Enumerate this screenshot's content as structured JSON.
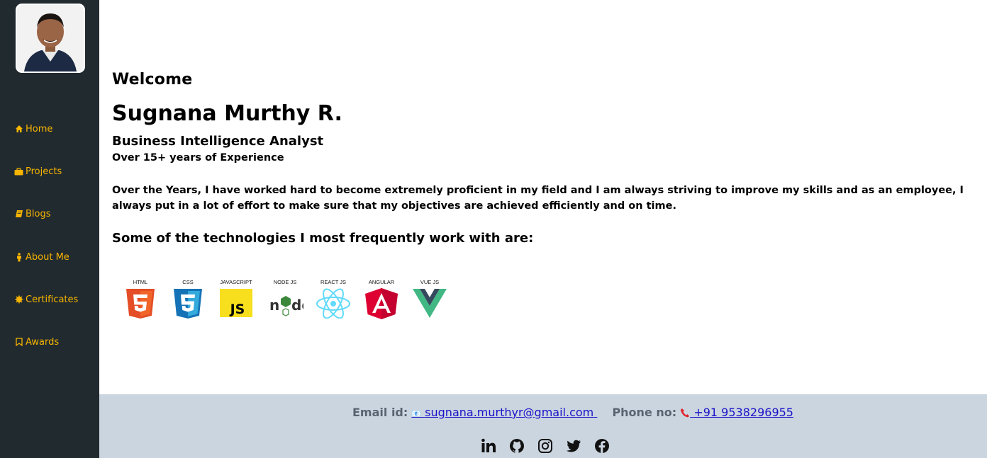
{
  "sidebar": {
    "items": [
      {
        "label": "Home",
        "icon": "home-icon"
      },
      {
        "label": "Projects",
        "icon": "briefcase-icon"
      },
      {
        "label": "Blogs",
        "icon": "book-icon"
      },
      {
        "label": "About Me",
        "icon": "person-icon"
      },
      {
        "label": "Certificates",
        "icon": "certificate-icon"
      },
      {
        "label": "Awards",
        "icon": "bookmark-icon"
      }
    ],
    "accent": "#f7b500",
    "background": "#212a2f"
  },
  "hero": {
    "welcome": "Welcome",
    "name": "Sugnana Murthy R.",
    "role": "Business Intelligence Analyst",
    "experience": "Over 15+ years of Experience",
    "paragraph": "Over the Years, I have worked hard to become extremely proficient in my field and I am always striving to improve my skills and as an employee, I always put in a lot of effort to make sure that my objectives are achieved efficiently and on time.",
    "tech_heading": "Some of the technologies I most frequently work with are:"
  },
  "technologies": [
    {
      "label": "HTML",
      "icon": "html5-icon"
    },
    {
      "label": "CSS",
      "icon": "css3-icon"
    },
    {
      "label": "JAVASCRIPT",
      "icon": "javascript-icon"
    },
    {
      "label": "NODE JS",
      "icon": "nodejs-icon"
    },
    {
      "label": "REACT JS",
      "icon": "react-icon"
    },
    {
      "label": "ANGULAR",
      "icon": "angular-icon"
    },
    {
      "label": "VUE JS",
      "icon": "vue-icon"
    }
  ],
  "footer": {
    "email_label": "Email id:",
    "email": "sugnana.murthyr@gmail.com",
    "phone_label": "Phone no:",
    "phone": "+91 9538296955",
    "socials": [
      "linkedin-icon",
      "github-icon",
      "instagram-icon",
      "twitter-icon",
      "facebook-icon"
    ],
    "background": "#cbd5e0"
  }
}
